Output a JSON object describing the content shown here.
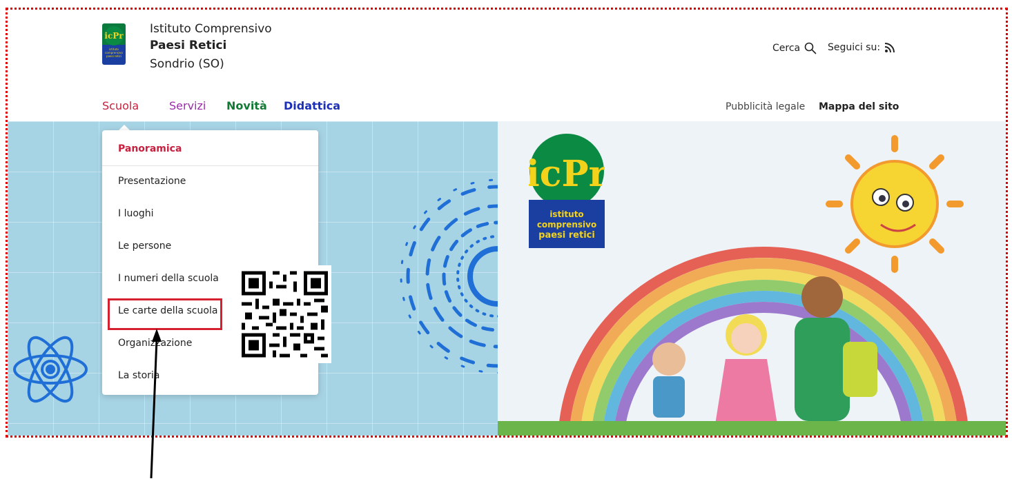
{
  "header": {
    "brand_line1": "Istituto Comprensivo",
    "brand_line2": "Paesi Retici",
    "brand_line3": "Sondrio (SO)",
    "logo_text": "icPr",
    "logo_sub": "istituto comprensivo paesi retici",
    "search_label": "Cerca",
    "follow_label": "Seguici su:"
  },
  "nav": {
    "items": [
      "Scuola",
      "Servizi",
      "Novità",
      "Didattica"
    ],
    "utility": [
      "Pubblicità legale",
      "Mappa del sito"
    ]
  },
  "dropdown": {
    "heading": "Panoramica",
    "items": [
      "Presentazione",
      "I luoghi",
      "Le persone",
      "I numeri della scuola",
      "Le carte della scuola",
      "Organizzazione",
      "La storia"
    ],
    "highlighted": "Le carte della scuola"
  },
  "hero": {
    "logo_text": "icPr",
    "logo_caption": [
      "istituto",
      "comprensivo",
      "paesi retici"
    ]
  },
  "colors": {
    "frame_border": "#e00000",
    "hero_bg": "#a7d4e5",
    "scuola": "#c8203e",
    "servizi": "#9a2aa9",
    "novita": "#127a35",
    "didattica": "#1d2fb6",
    "highlight": "#d4202f"
  },
  "icons": [
    "search-icon",
    "rss-icon",
    "atom-icon",
    "qr-code",
    "arrow-icon"
  ]
}
